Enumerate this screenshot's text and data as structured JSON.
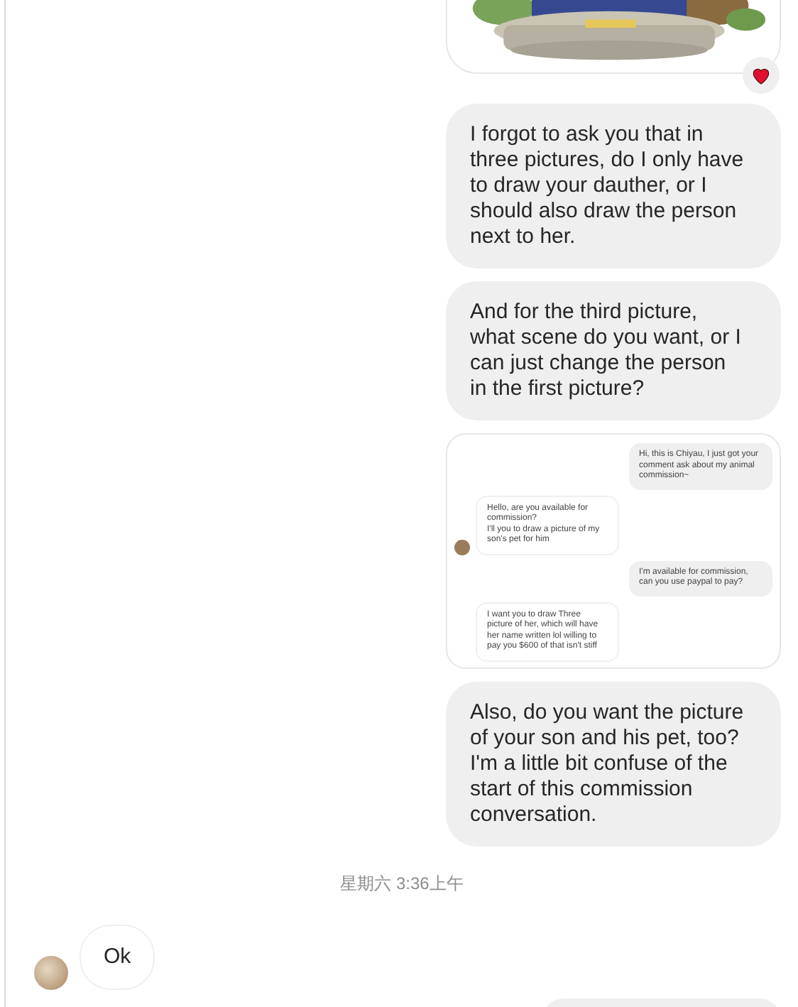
{
  "messages": [
    {
      "kind": "picture",
      "from_me": true,
      "reacted": true
    },
    {
      "kind": "text",
      "from_me": true,
      "text": "I forgot to ask you that in three pictures, do I only have to draw your dauther, or I should also draw the person next to her."
    },
    {
      "kind": "text",
      "from_me": true,
      "text": "And for the third picture, what scene do you want, or I can just change the person in the first picture?"
    },
    {
      "kind": "screenshot",
      "from_me": true,
      "messages": [
        {
          "from_me": true,
          "text": "Hi, this is Chiyau, I just got your comment ask about my animal commission~"
        },
        {
          "from_me": false,
          "text": "Hello, are you available for commission?\nI'll you to draw a picture of my son's pet for him"
        },
        {
          "from_me": true,
          "text": "I'm available for commission, can you use paypal to pay?"
        },
        {
          "from_me": false,
          "text": "I want you to draw Three picture of her, which will have her name written lol willing to pay you $600 of that isn't stiff"
        }
      ]
    },
    {
      "kind": "text",
      "from_me": true,
      "text": "Also, do you want the picture of your son and his pet, too? I'm a little bit confuse of the start of this commission conversation."
    },
    {
      "kind": "timestamp",
      "text": "星期六 3:36上午"
    },
    {
      "kind": "text",
      "from_me": false,
      "text": "Ok"
    },
    {
      "kind": "partial",
      "from_me": true
    }
  ]
}
